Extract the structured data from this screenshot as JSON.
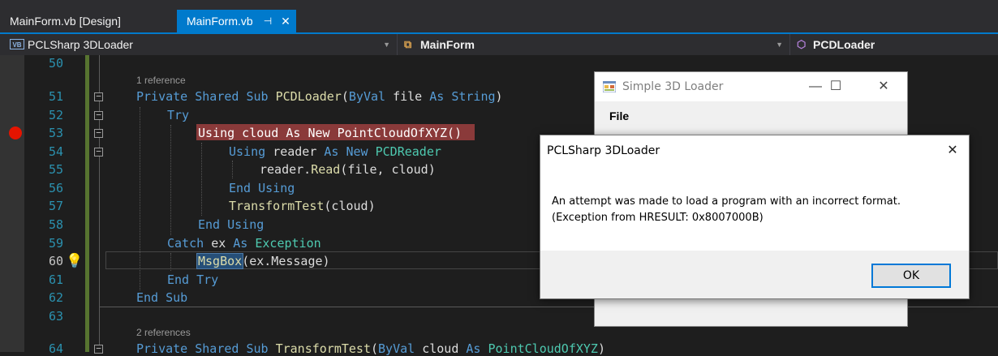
{
  "tabs": {
    "design_tab": "MainForm.vb [Design]",
    "active_tab": "MainForm.vb",
    "pin_glyph": "⊣",
    "close_glyph": "✕"
  },
  "navbar": {
    "project": "PCLSharp 3DLoader",
    "project_icon": "VB",
    "class": "MainForm",
    "member": "PCDLoader"
  },
  "editor": {
    "line_numbers": [
      "50",
      "51",
      "52",
      "53",
      "54",
      "55",
      "56",
      "57",
      "58",
      "59",
      "60",
      "61",
      "62",
      "63",
      "64"
    ],
    "codelens": [
      "1 reference",
      "2 references"
    ],
    "line51": {
      "k1": "Private Shared Sub ",
      "fn": "PCDLoader",
      "p1": "(",
      "k2": "ByVal",
      " file": " file ",
      "k3": "As String",
      ")": ")"
    },
    "line52": "Try",
    "line53": "Using cloud As New PointCloudOfXYZ()",
    "line54": {
      "k": "Using ",
      "id": "reader ",
      "k2": "As New ",
      "ty": "PCDReader"
    },
    "line55": {
      "a": "reader.",
      "fn": "Read",
      "b": "(file, cloud)"
    },
    "line56": "End Using",
    "line57": {
      "fn": "TransformTest",
      "b": "(cloud)"
    },
    "line58": "End Using",
    "line59": {
      "k": "Catch ",
      "id": "ex ",
      "k2": "As ",
      "ty": "Exception"
    },
    "line60": {
      "fn": "MsgBox",
      "b": "(ex.Message)"
    },
    "line61": "End Try",
    "line62": "End Sub",
    "line64": {
      "k1": "Private Shared Sub ",
      "fn": "TransformTest",
      "p1": "(",
      "k2": "ByVal",
      "id": " cloud ",
      "k3": "As ",
      "ty": "PointCloudOfXYZ",
      "p2": ")"
    }
  },
  "app_window": {
    "title": "Simple 3D Loader",
    "menu_file": "File",
    "minimize_glyph": "—",
    "maximize_glyph": "☐",
    "close_glyph": "✕"
  },
  "message_box": {
    "title": "PCLSharp 3DLoader",
    "text": "An attempt was made to load a program with an incorrect format. (Exception from HRESULT: 0x8007000B)",
    "ok_label": "OK",
    "close_glyph": "✕"
  },
  "colors": {
    "accent": "#007acc",
    "breakpoint": "#e51400",
    "change_bar": "#577430"
  }
}
